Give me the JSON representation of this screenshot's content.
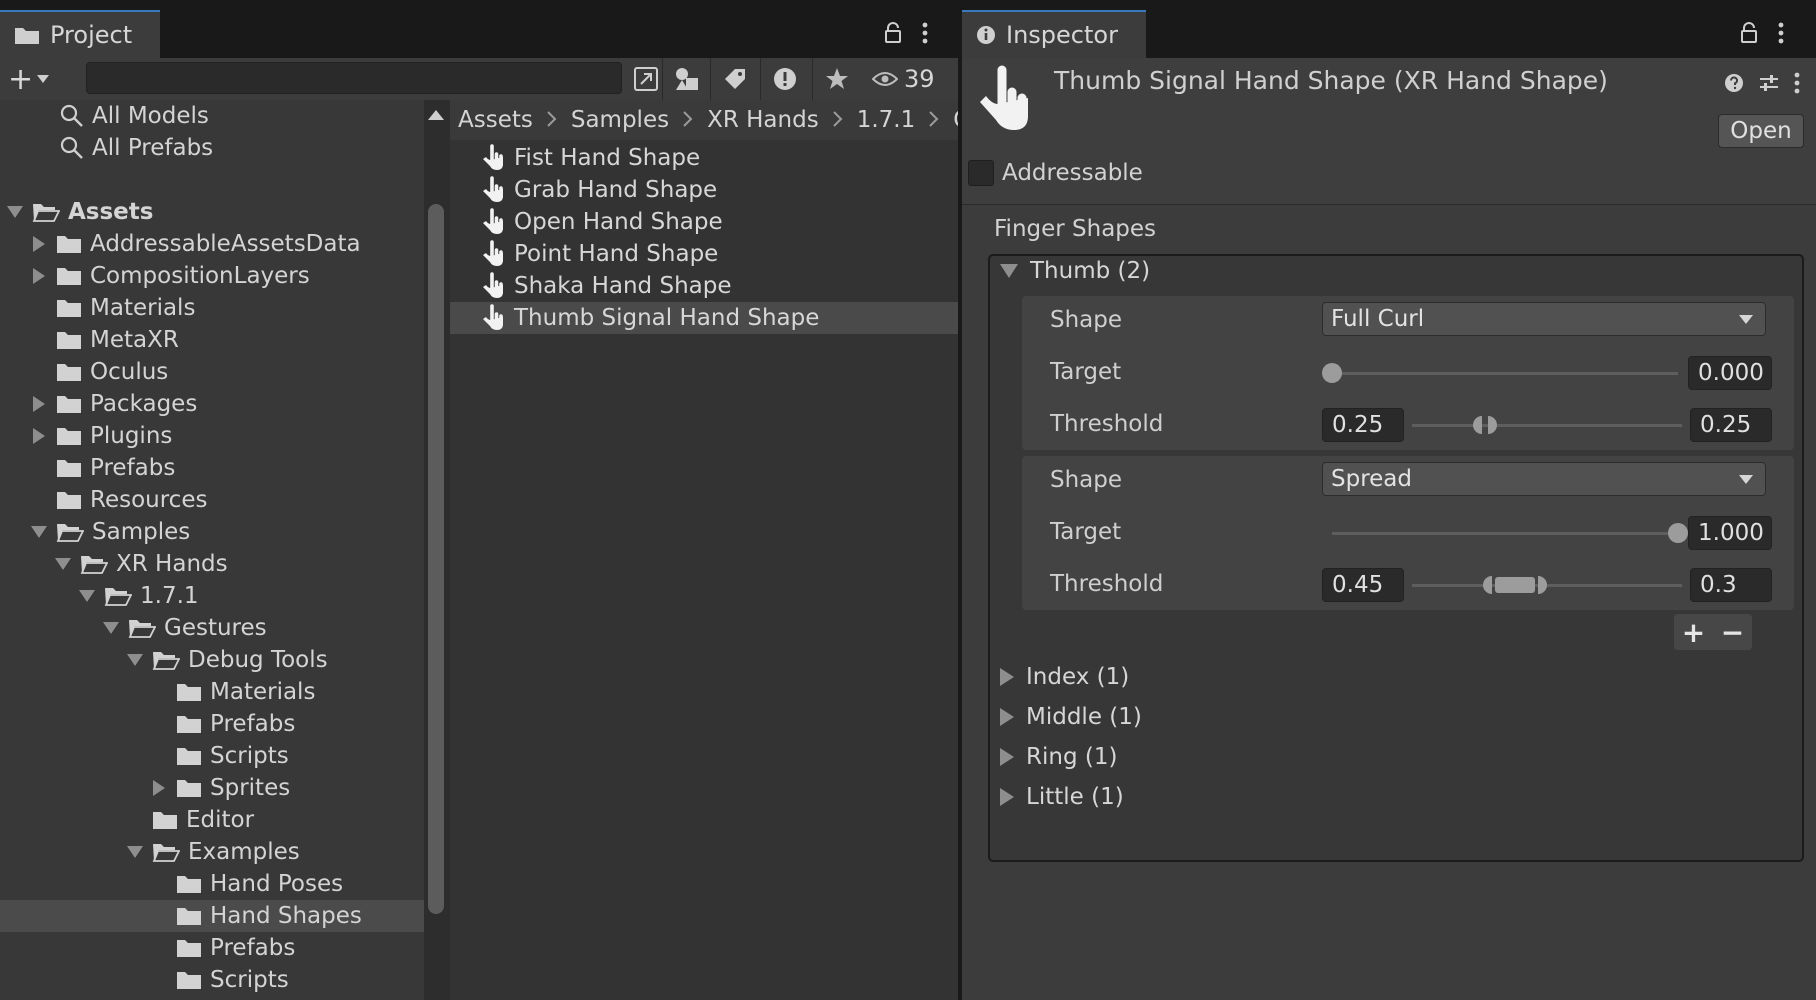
{
  "project": {
    "tab_label": "Project",
    "search_value": "",
    "hidden_count": "39",
    "favorites": [
      "All Models",
      "All Prefabs"
    ],
    "tree": [
      {
        "label": "Assets",
        "depth": 0,
        "expanded": true,
        "arrow": "down",
        "bold": true
      },
      {
        "label": "AddressableAssetsData",
        "depth": 1,
        "arrow": "right"
      },
      {
        "label": "CompositionLayers",
        "depth": 1,
        "arrow": "right"
      },
      {
        "label": "Materials",
        "depth": 1,
        "arrow": "none"
      },
      {
        "label": "MetaXR",
        "depth": 1,
        "arrow": "none"
      },
      {
        "label": "Oculus",
        "depth": 1,
        "arrow": "none"
      },
      {
        "label": "Packages",
        "depth": 1,
        "arrow": "right"
      },
      {
        "label": "Plugins",
        "depth": 1,
        "arrow": "right"
      },
      {
        "label": "Prefabs",
        "depth": 1,
        "arrow": "none"
      },
      {
        "label": "Resources",
        "depth": 1,
        "arrow": "none"
      },
      {
        "label": "Samples",
        "depth": 1,
        "arrow": "down",
        "expanded": true
      },
      {
        "label": "XR Hands",
        "depth": 2,
        "arrow": "down",
        "expanded": true
      },
      {
        "label": "1.7.1",
        "depth": 3,
        "arrow": "down",
        "expanded": true
      },
      {
        "label": "Gestures",
        "depth": 4,
        "arrow": "down",
        "expanded": true
      },
      {
        "label": "Debug Tools",
        "depth": 5,
        "arrow": "down",
        "expanded": true
      },
      {
        "label": "Materials",
        "depth": 6,
        "arrow": "none"
      },
      {
        "label": "Prefabs",
        "depth": 6,
        "arrow": "none"
      },
      {
        "label": "Scripts",
        "depth": 6,
        "arrow": "none"
      },
      {
        "label": "Sprites",
        "depth": 6,
        "arrow": "right"
      },
      {
        "label": "Editor",
        "depth": 5,
        "arrow": "none"
      },
      {
        "label": "Examples",
        "depth": 5,
        "arrow": "down",
        "expanded": true
      },
      {
        "label": "Hand Poses",
        "depth": 6,
        "arrow": "none"
      },
      {
        "label": "Hand Shapes",
        "depth": 6,
        "arrow": "none",
        "selected": true
      },
      {
        "label": "Prefabs",
        "depth": 6,
        "arrow": "none"
      },
      {
        "label": "Scripts",
        "depth": 6,
        "arrow": "none"
      }
    ],
    "breadcrumb": [
      "Assets",
      "Samples",
      "XR Hands",
      "1.7.1",
      "Ge"
    ],
    "assets": [
      {
        "label": "Fist Hand Shape"
      },
      {
        "label": "Grab Hand Shape"
      },
      {
        "label": "Open Hand Shape"
      },
      {
        "label": "Point Hand Shape"
      },
      {
        "label": "Shaka Hand Shape"
      },
      {
        "label": "Thumb Signal Hand Shape",
        "selected": true
      }
    ]
  },
  "inspector": {
    "tab_label": "Inspector",
    "title": "Thumb Signal Hand Shape (XR Hand Shape)",
    "open_label": "Open",
    "addressable_label": "Addressable",
    "addressable_checked": false,
    "section_label": "Finger Shapes",
    "thumb_label": "Thumb (2)",
    "conditions": [
      {
        "shape_label": "Shape",
        "shape_value": "Full Curl",
        "target_label": "Target",
        "target_value": "0.000",
        "target_fraction": 0.0,
        "threshold_label": "Threshold",
        "threshold_lower": "0.25",
        "threshold_upper": "0.25"
      },
      {
        "shape_label": "Shape",
        "shape_value": "Spread",
        "target_label": "Target",
        "target_value": "1.000",
        "target_fraction": 1.0,
        "threshold_label": "Threshold",
        "threshold_lower": "0.45",
        "threshold_upper": "0.3"
      }
    ],
    "add_symbol": "+",
    "remove_symbol": "−",
    "collapsed_fingers": [
      "Index (1)",
      "Middle (1)",
      "Ring (1)",
      "Little (1)"
    ]
  },
  "icons": {
    "folder": "folder-icon",
    "hand": "hand-shape-icon",
    "search": "search-icon",
    "lock": "lock-icon",
    "kebab": "kebab-menu-icon",
    "info": "info-icon",
    "help": "help-icon",
    "settings": "settings-icon"
  }
}
